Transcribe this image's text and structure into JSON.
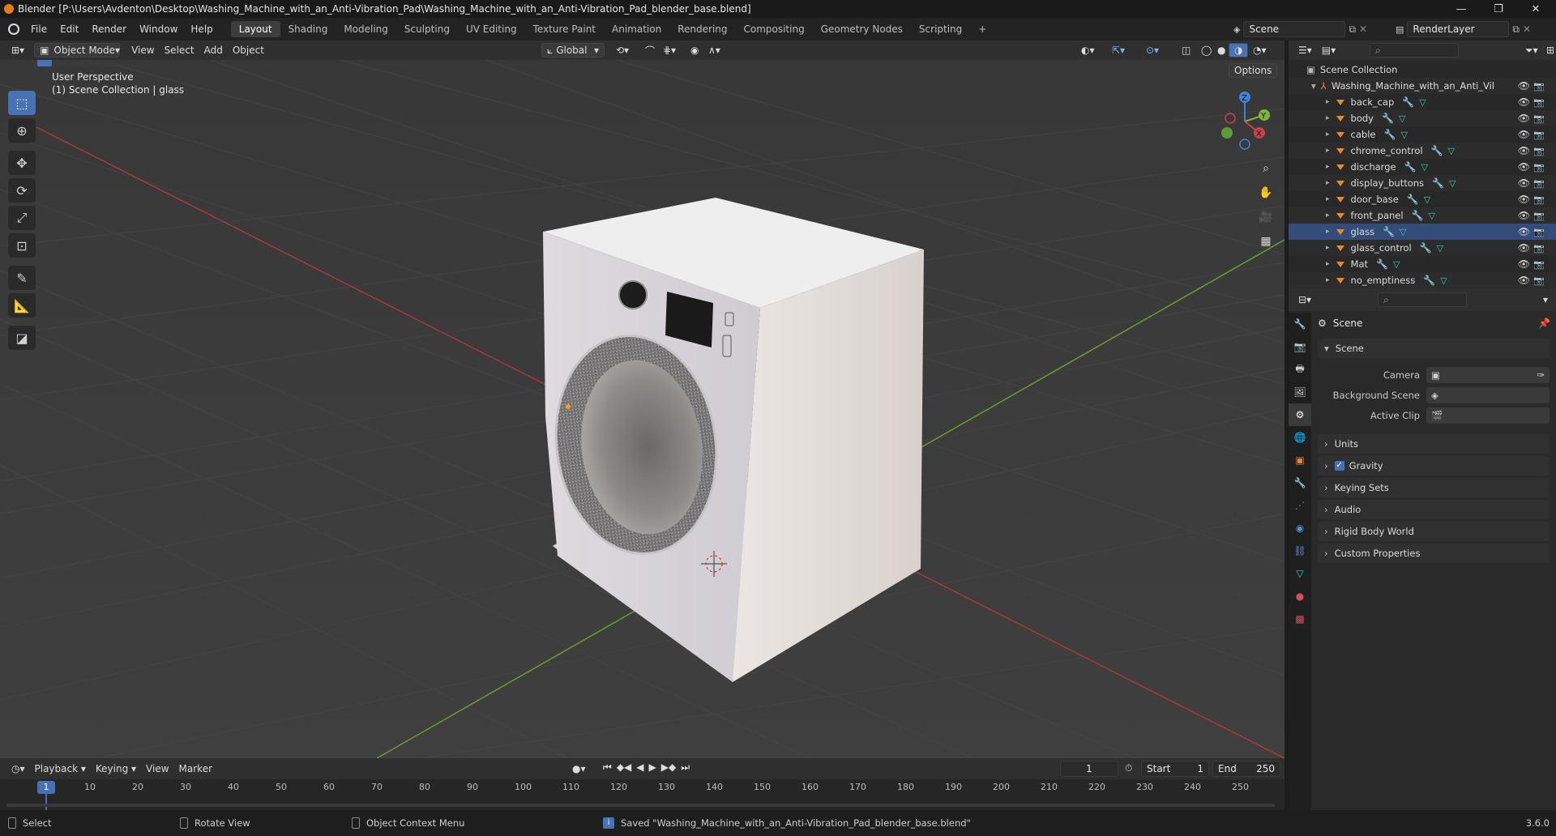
{
  "window": {
    "title": "Blender [P:\\Users\\Avdenton\\Desktop\\Washing_Machine_with_an_Anti-Vibration_Pad\\Washing_Machine_with_an_Anti-Vibration_Pad_blender_base.blend]",
    "controls": {
      "minimize": "—",
      "maximize": "❐",
      "close": "✕"
    }
  },
  "menubar": {
    "items": [
      "File",
      "Edit",
      "Render",
      "Window",
      "Help"
    ],
    "workspaces": [
      "Layout",
      "Shading",
      "Modeling",
      "Sculpting",
      "UV Editing",
      "Texture Paint",
      "Animation",
      "Rendering",
      "Compositing",
      "Geometry Nodes",
      "Scripting"
    ],
    "active_workspace": "Layout",
    "add_workspace": "+",
    "scene": "Scene",
    "view_layer": "RenderLayer"
  },
  "viewport_header": {
    "mode": "Object Mode",
    "menus": [
      "View",
      "Select",
      "Add",
      "Object"
    ],
    "transform_orientation": "Global",
    "options": "Options"
  },
  "viewport": {
    "view_name": "User Perspective",
    "collection_info": "(1) Scene Collection | glass",
    "gizmo": {
      "z": "Z",
      "y": "Y",
      "x": "X"
    },
    "colors": {
      "x_axis": "#c8404a",
      "y_axis": "#7fb33b",
      "z_axis": "#3d84d6",
      "grid_bg": "#3d3d3d"
    }
  },
  "toolbar": {
    "tools": [
      "select-box",
      "cursor",
      "move",
      "rotate",
      "scale",
      "transform",
      "annotate",
      "measure",
      "add-cube"
    ],
    "active": "select-box"
  },
  "outliner": {
    "root": "Scene Collection",
    "collection": "Washing_Machine_with_an_Anti_Vibrati",
    "objects": [
      "back_cap",
      "body",
      "cable",
      "chrome_control",
      "discharge",
      "display_buttons",
      "door_base",
      "front_panel",
      "glass",
      "glass_control",
      "Mat",
      "no_emptiness"
    ],
    "selected": "glass"
  },
  "properties": {
    "context": "Scene",
    "panel_title": "Scene",
    "fields": [
      {
        "label": "Camera",
        "value": ""
      },
      {
        "label": "Background Scene",
        "value": ""
      },
      {
        "label": "Active Clip",
        "value": ""
      }
    ],
    "collapsed_sections": [
      "Units",
      "Gravity",
      "Keying Sets",
      "Audio",
      "Rigid Body World",
      "Custom Properties"
    ],
    "gravity_checked": true
  },
  "timeline": {
    "menus": [
      "Playback",
      "Keying",
      "View",
      "Marker"
    ],
    "current_frame": "1",
    "start_label": "Start",
    "start": "1",
    "end_label": "End",
    "end": "250",
    "ruler": [
      "10",
      "20",
      "30",
      "40",
      "50",
      "60",
      "70",
      "80",
      "90",
      "100",
      "110",
      "120",
      "130",
      "140",
      "150",
      "160",
      "170",
      "180",
      "190",
      "200",
      "210",
      "220",
      "230",
      "240",
      "250"
    ],
    "playhead_label": "1"
  },
  "statusbar": {
    "select": "Select",
    "rotate": "Rotate View",
    "context_menu": "Object Context Menu",
    "message": "Saved \"Washing_Machine_with_an_Anti-Vibration_Pad_blender_base.blend\"",
    "version": "3.6.0"
  }
}
